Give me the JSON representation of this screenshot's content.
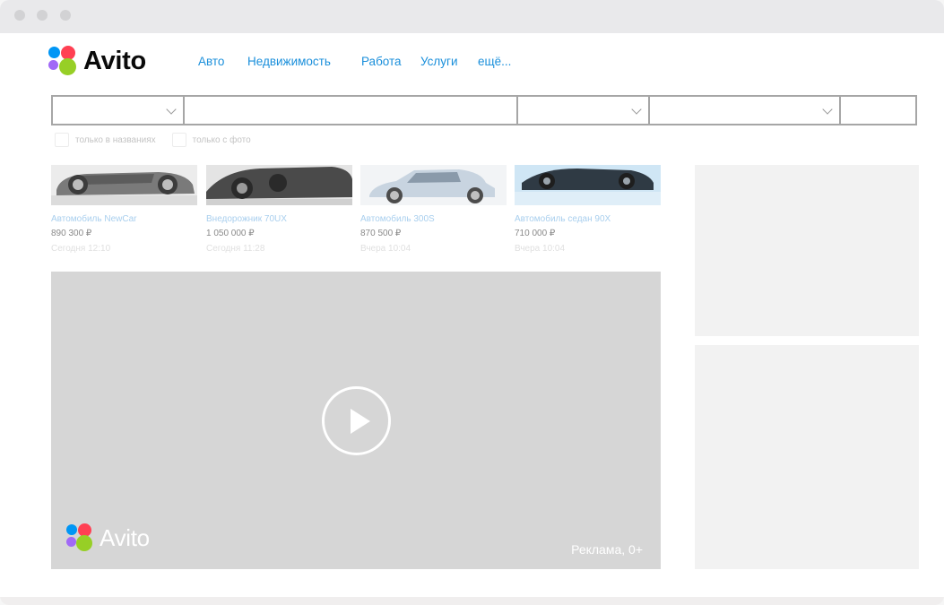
{
  "brand": {
    "name": "Avito",
    "dot_colors": [
      "#0096f5",
      "#97cf26",
      "#a169f7",
      "#ff4053"
    ]
  },
  "nav": {
    "items": [
      "Авто",
      "Недвижимость",
      "Работа",
      "Услуги",
      "ещё..."
    ],
    "color": "#1a8fdb"
  },
  "search": {
    "category_value": "",
    "query_value": "",
    "region_value": "",
    "radius_value": "",
    "submit_label": ""
  },
  "filters": {
    "only_titles": {
      "label": "только в названиях",
      "checked": false
    },
    "only_photo": {
      "label": "только с фото",
      "checked": false
    }
  },
  "listings": [
    {
      "title": "Автомобиль NewCar",
      "price": "890 300 ₽",
      "date": "Сегодня 12:10"
    },
    {
      "title": "Внедорожник 70UX",
      "price": "1 050 000 ₽",
      "date": "Сегодня 11:28"
    },
    {
      "title": "Автомобиль 300S",
      "price": "870 500 ₽",
      "date": "Вчера 10:04"
    },
    {
      "title": "Автомобиль седан 90X",
      "price": "710 000 ₽",
      "date": "Вчера 10:04"
    }
  ],
  "video_ad": {
    "brand": "Avito",
    "label": "Реклама, 0+",
    "play_icon": "play-icon"
  }
}
